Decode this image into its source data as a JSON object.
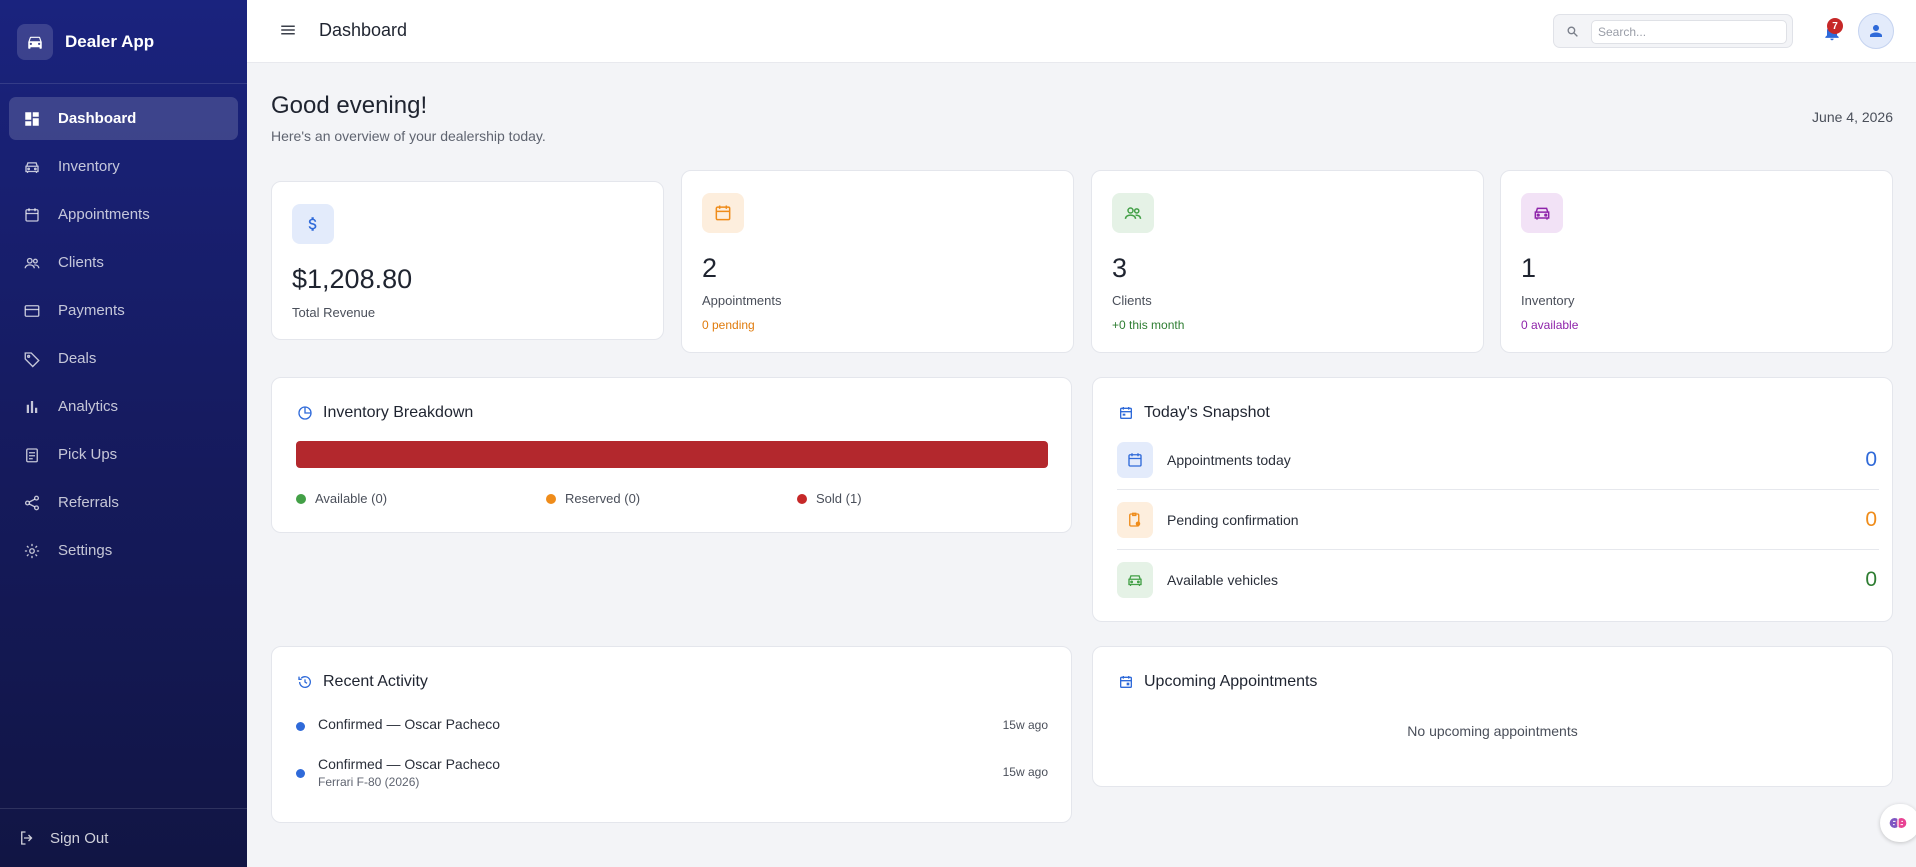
{
  "app": {
    "name": "Dealer App"
  },
  "sidebar": {
    "items": [
      {
        "label": "Dashboard",
        "icon": "dashboard-icon",
        "active": true
      },
      {
        "label": "Inventory",
        "icon": "car-icon"
      },
      {
        "label": "Appointments",
        "icon": "calendar-icon"
      },
      {
        "label": "Clients",
        "icon": "people-icon"
      },
      {
        "label": "Payments",
        "icon": "credit-card-icon"
      },
      {
        "label": "Deals",
        "icon": "tag-icon"
      },
      {
        "label": "Analytics",
        "icon": "bar-chart-icon"
      },
      {
        "label": "Pick Ups",
        "icon": "clipboard-icon"
      },
      {
        "label": "Referrals",
        "icon": "share-icon"
      },
      {
        "label": "Settings",
        "icon": "gear-icon"
      }
    ],
    "signout_label": "Sign Out"
  },
  "topbar": {
    "title": "Dashboard",
    "search_placeholder": "Search...",
    "notification_count": "7"
  },
  "main": {
    "greeting": "Good evening!",
    "subtitle": "Here's an overview of your dealership today.",
    "date": "June 4, 2026"
  },
  "stats": {
    "revenue": {
      "value": "$1,208.80",
      "label": "Total Revenue"
    },
    "appointments": {
      "value": "2",
      "label": "Appointments",
      "sub": "0 pending"
    },
    "clients": {
      "value": "3",
      "label": "Clients",
      "sub": "+0 this month"
    },
    "inventory": {
      "value": "1",
      "label": "Inventory",
      "sub": "0 available"
    }
  },
  "inventory_breakdown": {
    "title": "Inventory Breakdown",
    "legend": [
      {
        "label": "Available (0)",
        "color": "#43a047"
      },
      {
        "label": "Reserved (0)",
        "color": "#ef8c1a"
      },
      {
        "label": "Sold (1)",
        "color": "#c62828"
      }
    ]
  },
  "snapshot": {
    "title": "Today's Snapshot",
    "rows": [
      {
        "label": "Appointments today",
        "value": "0",
        "color": "#2f6ad9"
      },
      {
        "label": "Pending confirmation",
        "value": "0",
        "color": "#ef8c1a"
      },
      {
        "label": "Available vehicles",
        "value": "0",
        "color": "#2e7d32"
      }
    ]
  },
  "recent_activity": {
    "title": "Recent Activity",
    "items": [
      {
        "text": "Confirmed — Oscar Pacheco",
        "sub": "",
        "time": "15w ago"
      },
      {
        "text": "Confirmed — Oscar Pacheco",
        "sub": "Ferrari F-80 (2026)",
        "time": "15w ago"
      }
    ]
  },
  "upcoming": {
    "title": "Upcoming Appointments",
    "empty": "No upcoming appointments"
  },
  "colors": {
    "sidebar": "#1a237e",
    "accent": "#2f6ad9",
    "sold": "#b3282d"
  }
}
